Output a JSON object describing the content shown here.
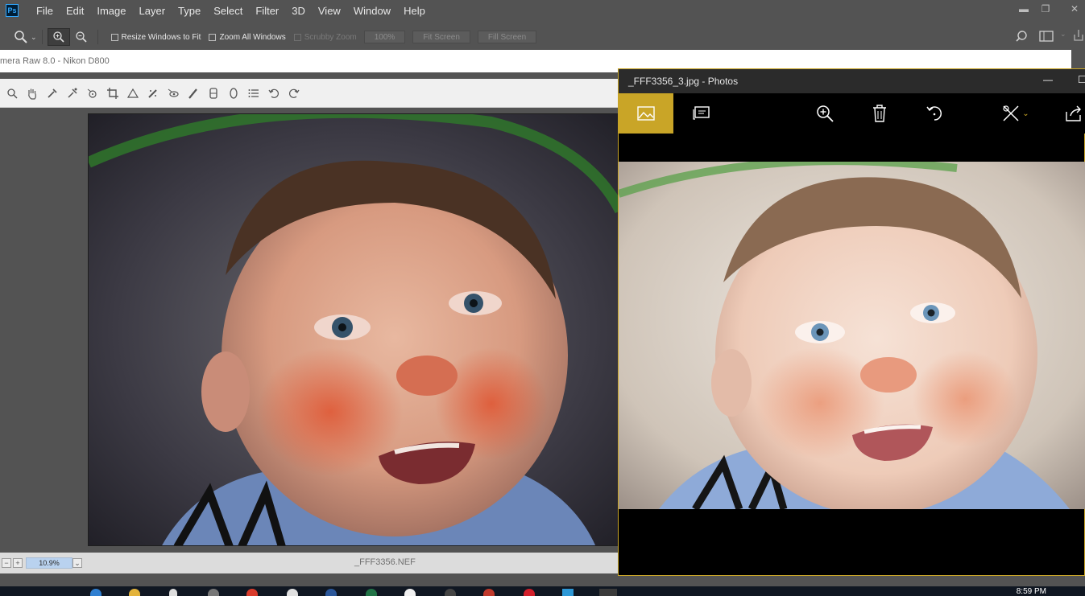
{
  "ps": {
    "logo": "Ps",
    "menu": [
      "File",
      "Edit",
      "Image",
      "Layer",
      "Type",
      "Select",
      "Filter",
      "3D",
      "View",
      "Window",
      "Help"
    ]
  },
  "options": {
    "resize_windows": "Resize Windows to Fit",
    "zoom_all": "Zoom All Windows",
    "scrubby": "Scrubby Zoom",
    "zoom_pct": "100%",
    "fit_screen": "Fit Screen",
    "fill_screen": "Fill Screen"
  },
  "acr": {
    "title": "mera Raw 8.0  -  Nikon D800",
    "zoom": "10.9%",
    "filename": "_FFF3356.NEF"
  },
  "photos": {
    "title": "_FFF3356_3.jpg - Photos"
  },
  "taskbar": {
    "clock": "8:59 PM"
  }
}
